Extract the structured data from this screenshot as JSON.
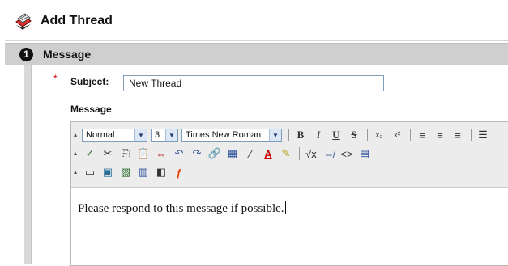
{
  "header": {
    "title": "Add Thread",
    "icon": "thread-icon"
  },
  "section": {
    "step": "1",
    "title": "Message"
  },
  "form": {
    "required_marker": "*",
    "subject_label": "Subject:",
    "subject_value": "New Thread",
    "message_label": "Message"
  },
  "toolbar": {
    "format_value": "Normal",
    "size_value": "3",
    "font_value": "Times New Roman",
    "bold": "B",
    "italic": "I",
    "underline": "U",
    "strike": "S"
  },
  "editor": {
    "body": "Please respond to this message if possible."
  },
  "colors": {
    "section_bar": "#cfcfcf",
    "required": "#d40000",
    "input_border": "#7f9db9"
  }
}
